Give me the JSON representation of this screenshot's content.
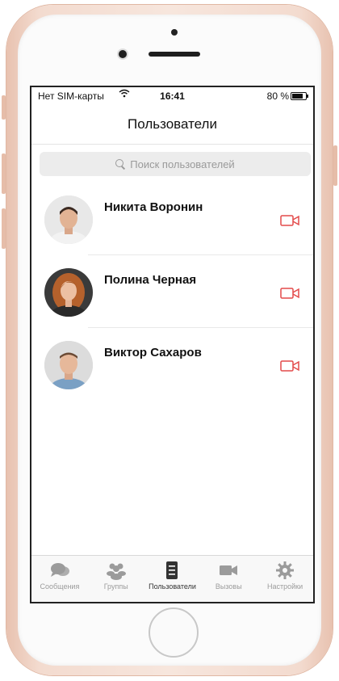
{
  "status_bar": {
    "carrier": "Нет SIM-карты",
    "time": "16:41",
    "battery": "80 %",
    "battery_level": 0.8
  },
  "nav": {
    "title": "Пользователи"
  },
  "search": {
    "placeholder": "Поиск пользователей"
  },
  "users": [
    {
      "name": "Никита Воронин"
    },
    {
      "name": "Полина Черная"
    },
    {
      "name": "Виктор Сахаров"
    }
  ],
  "tabs": [
    {
      "label": "Сообщения",
      "icon": "chat-bubbles-icon",
      "active": false
    },
    {
      "label": "Группы",
      "icon": "people-icon",
      "active": false
    },
    {
      "label": "Пользователи",
      "icon": "contacts-list-icon",
      "active": true
    },
    {
      "label": "Вызовы",
      "icon": "video-camera-icon",
      "active": false
    },
    {
      "label": "Настройки",
      "icon": "gear-icon",
      "active": false
    }
  ],
  "colors": {
    "accent": "#e34a4a",
    "tab_inactive": "#9b9b9b",
    "tab_active": "#333333"
  }
}
